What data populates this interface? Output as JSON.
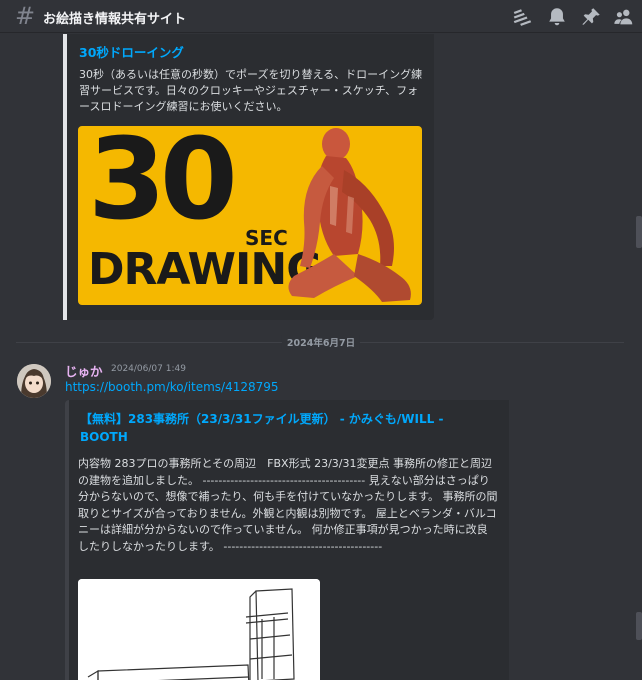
{
  "header": {
    "hash": "#",
    "channel_name": "お絵描き情報共有サイト",
    "icons": [
      "threads-icon",
      "notification-bell-icon",
      "pinned-messages-icon",
      "member-list-icon"
    ]
  },
  "embed1": {
    "title": "30秒ドローイング",
    "description": "30秒（あるいは任意の秒数）でポーズを切り替える、ドローイング練習サービスです。日々のクロッキーやジェスチャー・スケッチ、フォースロドーイング練習にお使いください。",
    "thumbnail": {
      "big_text": "30",
      "sec_text": "SEC",
      "drawing_text": "DRAWING"
    }
  },
  "date_divider": "2024年6月7日",
  "message": {
    "username": "じゅか",
    "timestamp": "2024/06/07 1:49",
    "link": "https://booth.pm/ko/items/4128795"
  },
  "embed2": {
    "title": "【無料】283事務所（23/3/31ファイル更新） - かみぐも/WILL - BOOTH",
    "description": "内容物 283プロの事務所とその周辺　FBX形式 23/3/31変更点 事務所の修正と周辺の建物を追加しました。 ----------------------------------------- 見えない部分はさっぱり分からないので、想像で補ったり、何も手を付けていなかったりします。 事務所の間取りとサイズが合っておりません。外観と内観は別物です。 屋上とベランダ・バルコニーは詳細が分からないので作っていません。 何か修正事項が見つかった時に改良したりしなかったりします。 ----------------------------------------"
  },
  "colors": {
    "background": "#313338",
    "embed_bg": "#2b2d31",
    "link": "#00a8fc",
    "username": "#e7b3f2",
    "thumbnail_yellow": "#f5b800"
  }
}
